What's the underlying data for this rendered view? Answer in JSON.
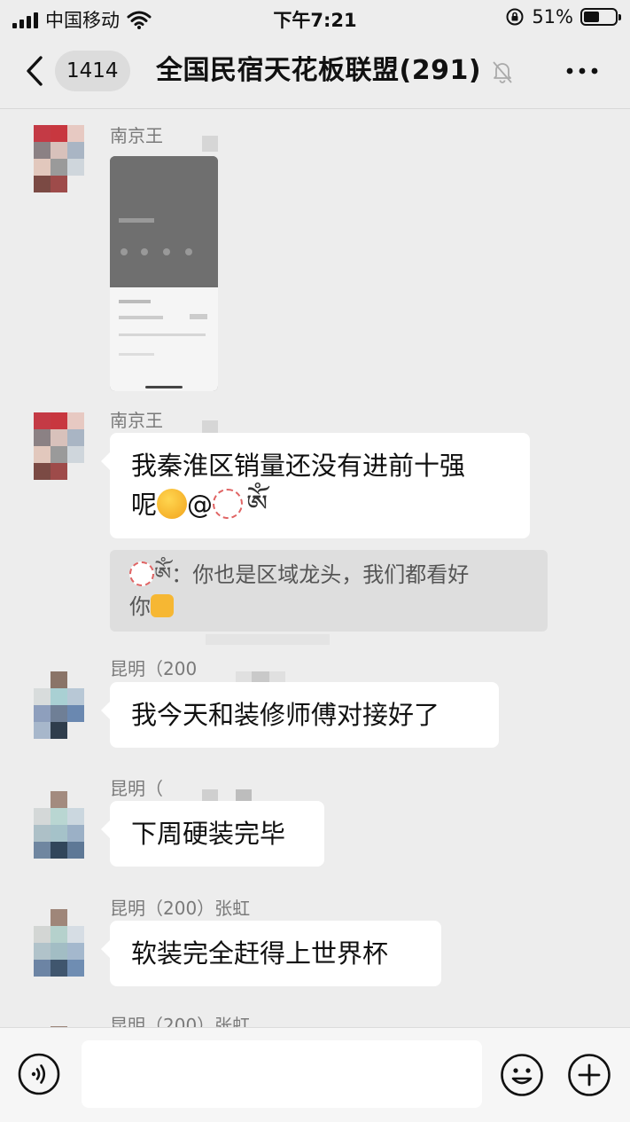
{
  "status_bar": {
    "carrier": "中国移动",
    "time": "下午7:21",
    "battery_text": "51%",
    "battery_level": 0.51
  },
  "nav": {
    "unread_count": "1414",
    "title": "全国民宿天花板联盟(291)"
  },
  "messages": [
    {
      "sender": "南京王",
      "type": "image"
    },
    {
      "sender": "南京王",
      "text_line1": "我秦淮区销量还没有进前十强",
      "text_line2_prefix": "呢",
      "mention": "@",
      "quote_text": "：你也是区域龙头，我们都看好",
      "quote_text2": "你"
    },
    {
      "sender": "昆明（200",
      "text": "我今天和装修师傅对接好了"
    },
    {
      "sender": "昆明（",
      "text": "下周硬装完毕"
    },
    {
      "sender": "昆明（200）张虹",
      "text": "软装完全赶得上世界杯"
    },
    {
      "sender": "昆明（200）张虹"
    }
  ],
  "colors": {
    "background": "#ededed",
    "bubble": "#ffffff",
    "quote": "#dedede",
    "sender_text": "#7a7a7a"
  },
  "icons": [
    "back-chevron-icon",
    "mute-bell-icon",
    "more-dots-icon",
    "voice-icon",
    "emoji-face-icon",
    "plus-icon",
    "wifi-icon",
    "lock-rotation-icon"
  ]
}
